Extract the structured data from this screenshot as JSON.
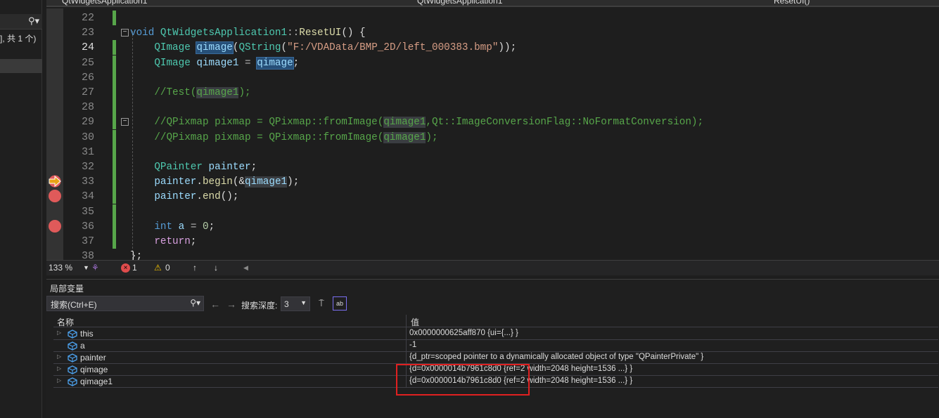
{
  "left_panel": {
    "search_icon": "search-icon",
    "result_text": "], 共 1 个)"
  },
  "navbar": {
    "project": "QtWidgetsApplication1",
    "scope": "QtWidgetsApplication1",
    "member": "ResetUI()"
  },
  "editor": {
    "current_line": 24,
    "breakpoints": [
      34,
      36
    ],
    "execution_line": 33,
    "lines": [
      {
        "n": "22",
        "seg": []
      },
      {
        "n": "23",
        "seg": [
          {
            "t": "void ",
            "k": "kw"
          },
          {
            "t": "QtWidgetsApplication1",
            "k": "type"
          },
          {
            "t": "::",
            "k": "op"
          },
          {
            "t": "ResetUI",
            "k": "fn"
          },
          {
            "t": "() {",
            "k": "plain"
          }
        ]
      },
      {
        "n": "24",
        "seg": [
          {
            "t": "    QImage ",
            "k": "type"
          },
          {
            "t": "qimage",
            "k": "var hl"
          },
          {
            "t": "(",
            "k": "plain"
          },
          {
            "t": "QString",
            "k": "type"
          },
          {
            "t": "(",
            "k": "plain"
          },
          {
            "t": "\"F:/VDAData/BMP_2D/left_000383.bmp\"",
            "k": "str"
          },
          {
            "t": "));",
            "k": "plain"
          }
        ]
      },
      {
        "n": "25",
        "seg": [
          {
            "t": "    QImage ",
            "k": "type"
          },
          {
            "t": "qimage1",
            "k": "var"
          },
          {
            "t": " = ",
            "k": "op"
          },
          {
            "t": "qimage",
            "k": "var hl"
          },
          {
            "t": ";",
            "k": "plain"
          }
        ]
      },
      {
        "n": "26",
        "seg": []
      },
      {
        "n": "27",
        "seg": [
          {
            "t": "    //Test(",
            "k": "cmt"
          },
          {
            "t": "qimage1",
            "k": "cmt ref"
          },
          {
            "t": ");",
            "k": "cmt"
          }
        ]
      },
      {
        "n": "28",
        "seg": []
      },
      {
        "n": "29",
        "seg": [
          {
            "t": "    //QPixmap pixmap = QPixmap::fromImage(",
            "k": "cmt"
          },
          {
            "t": "qimage1",
            "k": "cmt ref"
          },
          {
            "t": ",Qt::ImageConversionFlag::NoFormatConversion);",
            "k": "cmt"
          }
        ]
      },
      {
        "n": "30",
        "seg": [
          {
            "t": "    //QPixmap pixmap = QPixmap::fromImage(",
            "k": "cmt"
          },
          {
            "t": "qimage1",
            "k": "cmt ref"
          },
          {
            "t": ");",
            "k": "cmt"
          }
        ]
      },
      {
        "n": "31",
        "seg": []
      },
      {
        "n": "32",
        "seg": [
          {
            "t": "    QPainter ",
            "k": "type"
          },
          {
            "t": "painter",
            "k": "var"
          },
          {
            "t": ";",
            "k": "plain"
          }
        ]
      },
      {
        "n": "33",
        "seg": [
          {
            "t": "    painter",
            "k": "var"
          },
          {
            "t": ".",
            "k": "plain"
          },
          {
            "t": "begin",
            "k": "fn"
          },
          {
            "t": "(&",
            "k": "plain"
          },
          {
            "t": "qimage1",
            "k": "var ref"
          },
          {
            "t": ");",
            "k": "plain"
          }
        ]
      },
      {
        "n": "34",
        "seg": [
          {
            "t": "    painter",
            "k": "var"
          },
          {
            "t": ".",
            "k": "plain"
          },
          {
            "t": "end",
            "k": "fn"
          },
          {
            "t": "();",
            "k": "plain"
          }
        ]
      },
      {
        "n": "35",
        "seg": []
      },
      {
        "n": "36",
        "seg": [
          {
            "t": "    int ",
            "k": "kw"
          },
          {
            "t": "a",
            "k": "var"
          },
          {
            "t": " = ",
            "k": "op"
          },
          {
            "t": "0",
            "k": "num"
          },
          {
            "t": ";",
            "k": "plain"
          }
        ]
      },
      {
        "n": "37",
        "seg": [
          {
            "t": "    return",
            "k": "ctl"
          },
          {
            "t": ";",
            "k": "plain"
          }
        ]
      },
      {
        "n": "38",
        "seg": [
          {
            "t": "};",
            "k": "plain"
          }
        ]
      }
    ]
  },
  "status": {
    "zoom": "133 %",
    "errors": "1",
    "warnings": "0"
  },
  "locals": {
    "title": "局部变量",
    "search_placeholder": "搜索(Ctrl+E)",
    "depth_label": "搜索深度:",
    "depth_value": "3",
    "col_name": "名称",
    "col_value": "值",
    "rows": [
      {
        "name": "this",
        "value": "0x0000000625aff870 {ui={...} }",
        "expandable": true
      },
      {
        "name": "a",
        "value": "-1",
        "expandable": false
      },
      {
        "name": "painter",
        "value": "{d_ptr=scoped pointer to a dynamically allocated object of type \"QPainterPrivate\" }",
        "expandable": true
      },
      {
        "name": "qimage",
        "value": "{d=0x0000014b7961c8d0 {ref=2 width=2048 height=1536 ...} }",
        "expandable": true
      },
      {
        "name": "qimage1",
        "value": "{d=0x0000014b7961c8d0 {ref=2 width=2048 height=1536 ...} }",
        "expandable": true
      }
    ],
    "highlight_color": "#e02020"
  }
}
